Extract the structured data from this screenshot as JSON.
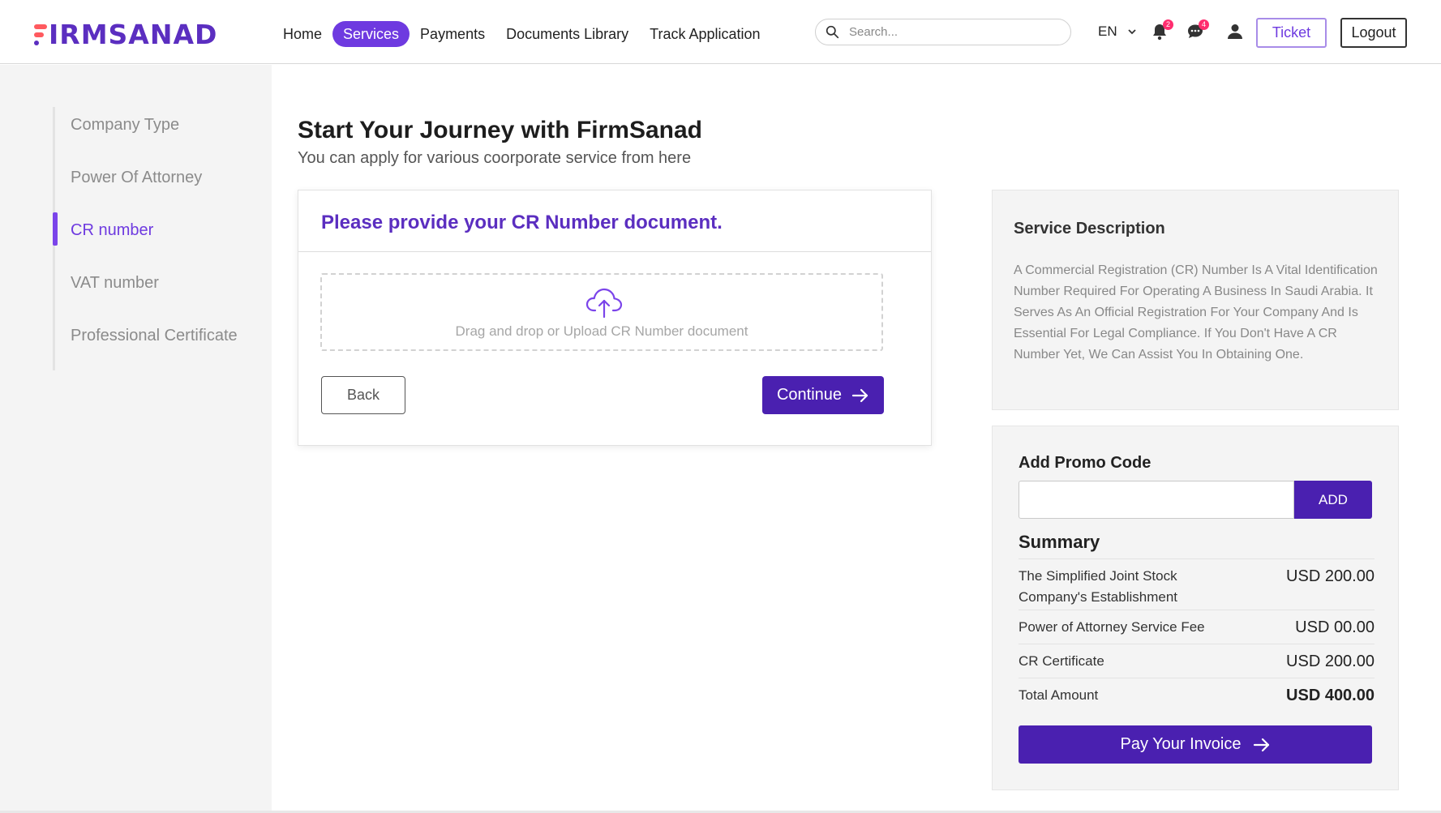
{
  "brand": {
    "logo_text": "IRMSANAD",
    "logo_full": "FIRMSANAD",
    "primary": "#4a20b0",
    "accent": "#6e3ae0",
    "logo_red": "#ff5a5f"
  },
  "nav": {
    "items": [
      {
        "label": "Home",
        "active": false
      },
      {
        "label": "Services",
        "active": true
      },
      {
        "label": "Payments",
        "active": false
      },
      {
        "label": "Documents Library",
        "active": false
      },
      {
        "label": "Track Application",
        "active": false
      }
    ]
  },
  "search": {
    "placeholder": "Search...",
    "icon": "search-icon"
  },
  "header": {
    "language": "EN",
    "notifications_count": "2",
    "messages_count": "4",
    "ticket_label": "Ticket",
    "logout_label": "Logout"
  },
  "sidebar": {
    "steps": [
      {
        "label": "Company Type",
        "active": false
      },
      {
        "label": "Power Of Attorney",
        "active": false
      },
      {
        "label": "CR number",
        "active": true
      },
      {
        "label": "VAT number",
        "active": false
      },
      {
        "label": "Professional Certificate",
        "active": false
      }
    ]
  },
  "main": {
    "title": "Start Your Journey with FirmSanad",
    "subtitle": "You can apply for various coorporate service from here",
    "upload_card": {
      "title": "Please provide your CR Number document.",
      "dropzone_text": "Drag and drop or Upload CR Number document",
      "back_label": "Back",
      "continue_label": "Continue"
    }
  },
  "service_description": {
    "title": "Service Description",
    "text": "A Commercial Registration (CR) Number Is A Vital Identification Number Required For Operating A Business In Saudi Arabia. It Serves As An Official Registration For Your Company And Is Essential For Legal Compliance. If You Don't Have A CR Number Yet, We Can Assist You In Obtaining One."
  },
  "promo": {
    "title": "Add Promo Code",
    "input_value": "",
    "add_label": "ADD"
  },
  "summary": {
    "title": "Summary",
    "rows": [
      {
        "label": "The Simplified Joint Stock Company's Establishment",
        "value": "USD 200.00"
      },
      {
        "label": "Power of Attorney Service Fee",
        "value": "USD 00.00"
      },
      {
        "label": "CR Certificate",
        "value": "USD 200.00"
      },
      {
        "label": "Total Amount",
        "value": "USD 400.00"
      }
    ],
    "pay_label": "Pay Your Invoice"
  }
}
